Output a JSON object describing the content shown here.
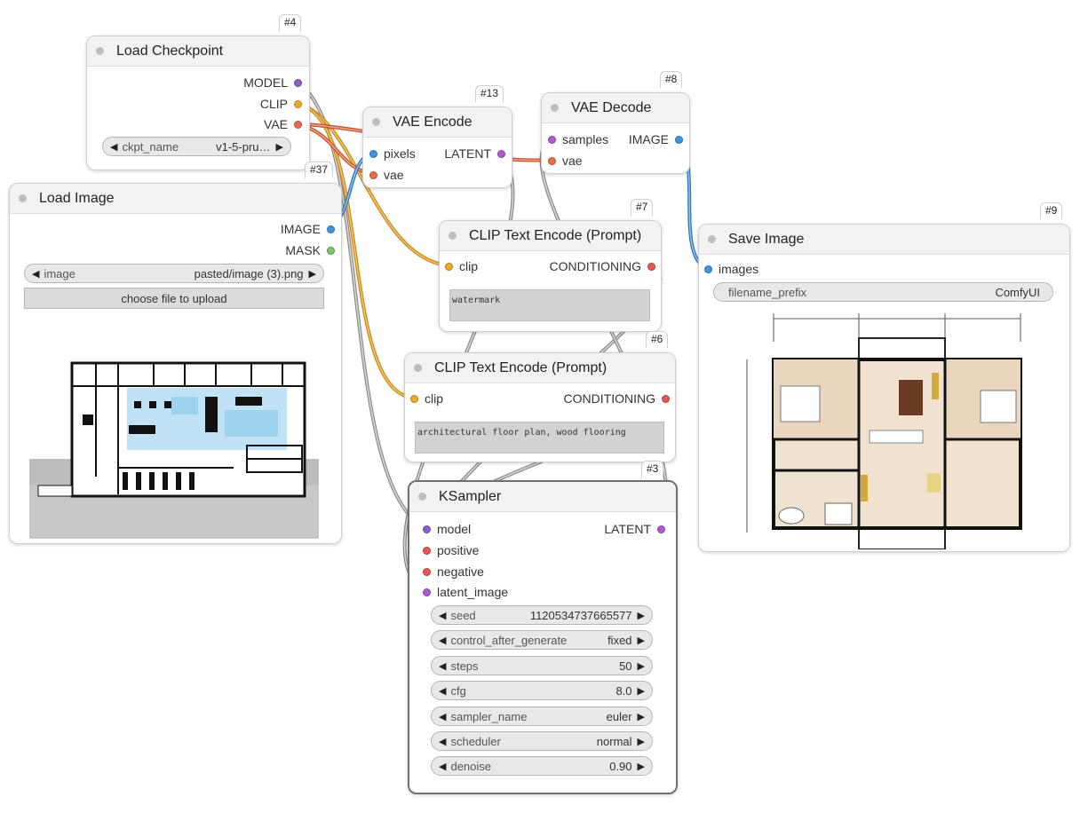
{
  "nodes": {
    "load_checkpoint": {
      "id": "#4",
      "title": "Load Checkpoint",
      "outputs": [
        "MODEL",
        "CLIP",
        "VAE"
      ],
      "ckpt": {
        "name": "ckpt_name",
        "value": "v1-5-pru…"
      }
    },
    "load_image": {
      "id": "#37",
      "title": "Load Image",
      "outputs": [
        "IMAGE",
        "MASK"
      ],
      "image": {
        "name": "image",
        "value": "pasted/image (3).png"
      },
      "upload_label": "choose file to upload"
    },
    "vae_encode": {
      "id": "#13",
      "title": "VAE Encode",
      "inputs": [
        "pixels",
        "vae"
      ],
      "output": "LATENT"
    },
    "vae_decode": {
      "id": "#8",
      "title": "VAE Decode",
      "inputs": [
        "samples",
        "vae"
      ],
      "output": "IMAGE"
    },
    "clip_text_7": {
      "id": "#7",
      "title": "CLIP Text Encode (Prompt)",
      "input": "clip",
      "output": "CONDITIONING",
      "text": "watermark"
    },
    "clip_text_6": {
      "id": "#6",
      "title": "CLIP Text Encode (Prompt)",
      "input": "clip",
      "output": "CONDITIONING",
      "text": "architectural floor plan, wood flooring"
    },
    "ksampler": {
      "id": "#3",
      "title": "KSampler",
      "inputs": [
        "model",
        "positive",
        "negative",
        "latent_image"
      ],
      "output": "LATENT",
      "widgets": [
        {
          "name": "seed",
          "value": "1120534737665577"
        },
        {
          "name": "control_after_generate",
          "value": "fixed"
        },
        {
          "name": "steps",
          "value": "50"
        },
        {
          "name": "cfg",
          "value": "8.0"
        },
        {
          "name": "sampler_name",
          "value": "euler"
        },
        {
          "name": "scheduler",
          "value": "normal"
        },
        {
          "name": "denoise",
          "value": "0.90"
        }
      ]
    },
    "save_image": {
      "id": "#9",
      "title": "Save Image",
      "input": "images",
      "prefix": {
        "name": "filename_prefix",
        "value": "ComfyUI"
      }
    }
  },
  "icons": {
    "decrement": "◀",
    "increment": "▶"
  },
  "colors": {
    "model": "#8a5fc9",
    "clip": "#f1a925",
    "vae": "#ec6a48",
    "image": "#3d95e0",
    "mask": "#7fc46e",
    "latent": "#b05ad0",
    "conditioning": "#e85555",
    "link_gray": "#9a9a9a"
  }
}
